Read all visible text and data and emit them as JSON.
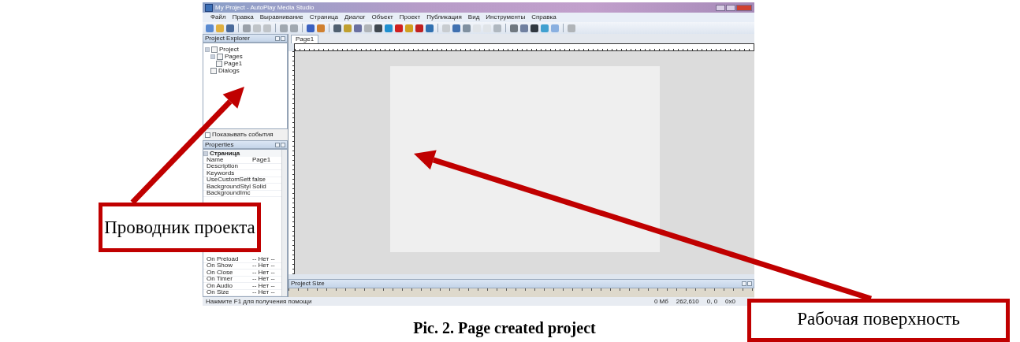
{
  "window": {
    "title": "My Project - AutoPlay Media Studio"
  },
  "menu": [
    "Файл",
    "Правка",
    "Выравнивание",
    "Страница",
    "Диалог",
    "Объект",
    "Проект",
    "Публикация",
    "Вид",
    "Инструменты",
    "Справка"
  ],
  "project_explorer": {
    "title": "Project Explorer",
    "tree": [
      {
        "label": "Project",
        "expanded": true,
        "children": [
          {
            "label": "Pages",
            "expanded": true,
            "children": [
              {
                "label": "Page1"
              }
            ]
          },
          {
            "label": "Dialogs"
          }
        ]
      }
    ],
    "show_events": {
      "label": "Показывать события",
      "checked": false
    }
  },
  "properties": {
    "title": "Properties",
    "group": "Страница",
    "group_expanded": true,
    "rows": [
      {
        "name": "Name",
        "value": "Page1"
      },
      {
        "name": "Description",
        "value": ""
      },
      {
        "name": "Keywords",
        "value": ""
      },
      {
        "name": "UseCustomSett",
        "value": "false"
      },
      {
        "name": "BackgroundStyl",
        "value": "Solid"
      },
      {
        "name": "BackgroundImc",
        "value": ""
      }
    ],
    "event_rows": [
      {
        "name": "On Preload",
        "value": "-- Нет --"
      },
      {
        "name": "On Show",
        "value": "-- Нет --"
      },
      {
        "name": "On Close",
        "value": "-- Нет --"
      },
      {
        "name": "On Timer",
        "value": "-- Нет --"
      },
      {
        "name": "On Audio",
        "value": "-- Нет --"
      },
      {
        "name": "On Size",
        "value": "-- Нет --"
      }
    ]
  },
  "tabs": [
    {
      "label": "Page1",
      "selected": true
    }
  ],
  "project_size": {
    "title": "Project Size"
  },
  "status_bar": {
    "hint": "Нажмите F1 для получения помощи",
    "size": "0 Мб",
    "count": "262,610",
    "position": "0, 0",
    "dimensions": "0x0"
  },
  "callouts": [
    {
      "text": "Проводник проекта"
    },
    {
      "text": "Рабочая поверхность"
    }
  ],
  "caption": "Pic. 2. Page created project"
}
